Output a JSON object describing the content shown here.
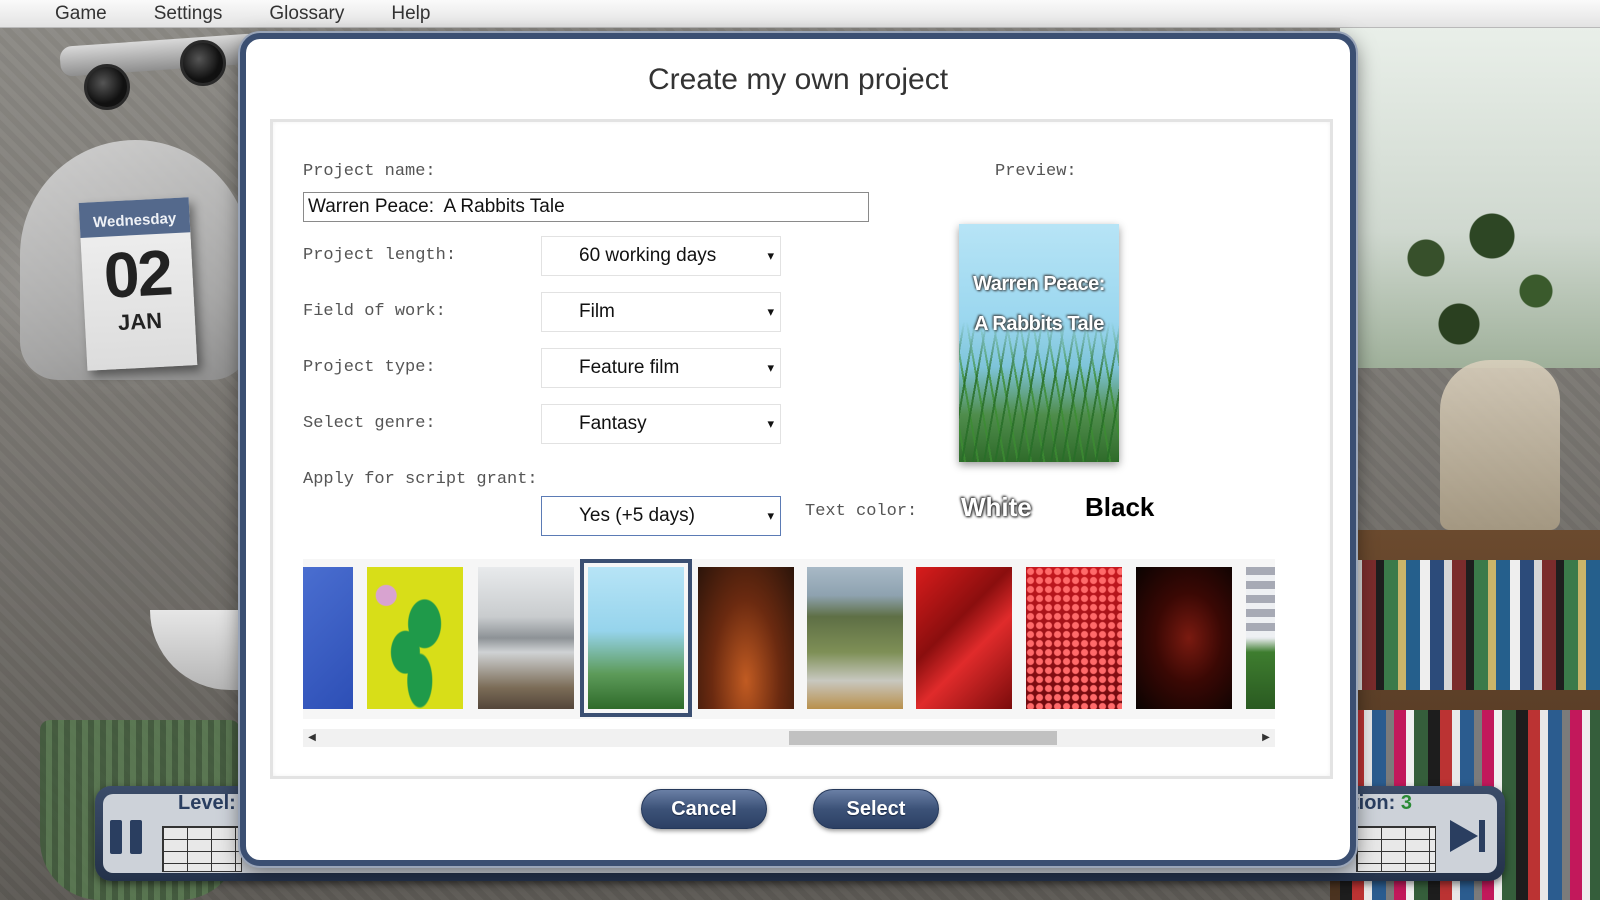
{
  "menu": {
    "items": [
      "Game",
      "Settings",
      "Glossary",
      "Help"
    ]
  },
  "calendar": {
    "weekday": "Wednesday",
    "day": "02",
    "month": "JAN"
  },
  "hud": {
    "level_label": "Level:",
    "position_label": "tion:",
    "position_value": "3",
    "pause_icon": "pause-icon",
    "skip_icon": "skip-forward-icon"
  },
  "dialog": {
    "title": "Create my own project",
    "project_name_label": "Project name:",
    "project_name_value": "Warren Peace:  A Rabbits Tale",
    "project_length_label": "Project length:",
    "project_length_value": "60 working days",
    "field_of_work_label": "Field of work:",
    "field_of_work_value": "Film",
    "project_type_label": "Project type:",
    "project_type_value": "Feature film",
    "genre_label": "Select genre:",
    "genre_value": "Fantasy",
    "script_grant_label": "Apply for script grant:",
    "script_grant_value": "Yes (+5 days)",
    "preview_label": "Preview:",
    "preview_title": "Warren Peace:\nA Rabbits Tale",
    "text_color_label": "Text color:",
    "text_color_white": "White",
    "text_color_black": "Black",
    "dropdown_arrow": "▾",
    "cancel_label": "Cancel",
    "select_label": "Select"
  },
  "thumbnails": {
    "count": 10,
    "selected_index": 3,
    "items": [
      "blue-fabric",
      "yellow-leaves",
      "misty-shore",
      "grass-sky",
      "sneaker-red-floor",
      "dining-lake-view",
      "red-abstract",
      "red-sequins",
      "dark-face",
      "striped-window-plant"
    ]
  },
  "colors": {
    "accent": "#3b4f72",
    "button_gradient_top": "#6a7fa5",
    "button_gradient_bottom": "#2c4064",
    "level_value_green": "#2a8a35"
  }
}
